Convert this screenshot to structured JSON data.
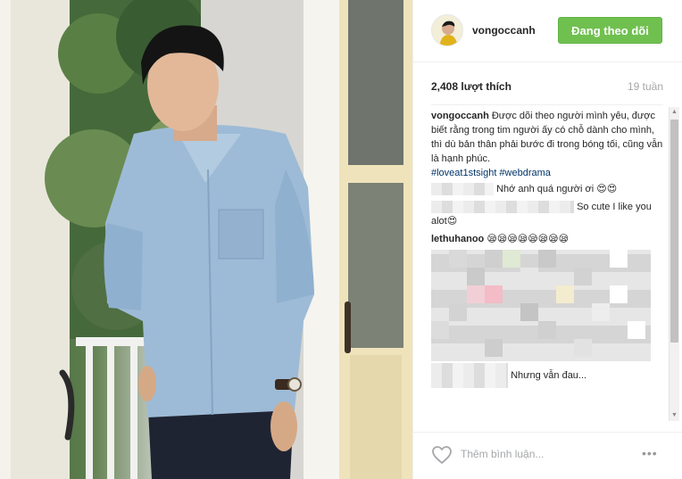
{
  "post": {
    "username": "vongoccanh",
    "follow_label": "Đang theo dõi",
    "likes": "2,408 lượt thích",
    "age": "19 tuần"
  },
  "caption": {
    "user": "vongoccanh",
    "text": "Được dõi theo người mình yêu, được biết rằng trong tim người ấy có chỗ dành cho mình, thì dù bản thân phải bước đi trong bóng tối, cũng vẫn là hạnh phúc.",
    "tags": "#loveat1stsight #webdrama"
  },
  "comments": [
    {
      "text": "Nhớ anh quá người ơi 😍😍"
    },
    {
      "text": "So cute I like you alot😍"
    },
    {
      "user": "lethuhanoo",
      "text": "😪😪😪😪😪😪😪😪"
    },
    {
      "text": "Nhưng vẫn đau..."
    }
  ],
  "footer": {
    "placeholder": "Thêm bình luận...",
    "more": "•••"
  },
  "icons": {
    "heart": "heart-outline-icon",
    "more": "more-options-icon"
  },
  "colors": {
    "follow_button": "#70c050",
    "hashtag": "#003569",
    "muted": "#a5a7aa"
  }
}
